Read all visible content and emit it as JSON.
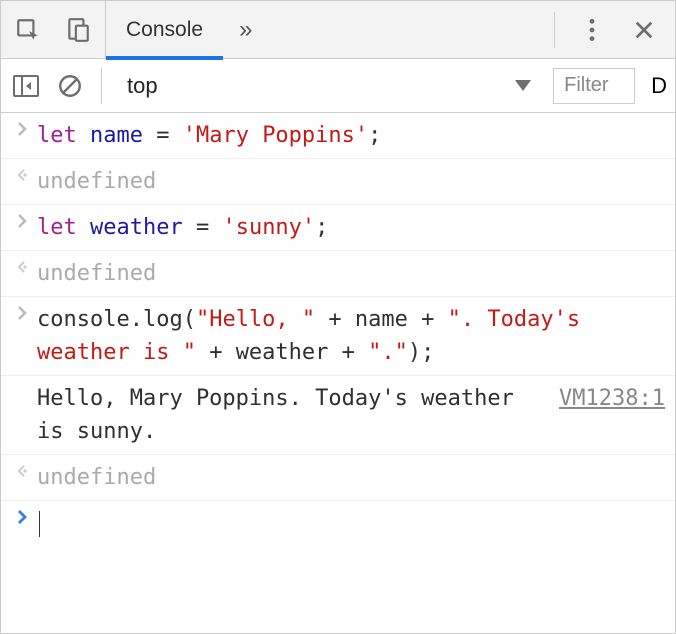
{
  "header": {
    "tabs": [
      {
        "label": "Console",
        "active": true
      }
    ],
    "moreGlyph": "»"
  },
  "toolbar": {
    "context": "top",
    "filterPlaceholder": "Filter",
    "rightText": "D"
  },
  "entries": [
    {
      "kind": "input",
      "code": {
        "segments": [
          {
            "t": "let ",
            "cls": "kw"
          },
          {
            "t": "name",
            "cls": "vname"
          },
          {
            "t": " = ",
            "cls": ""
          },
          {
            "t": "'Mary Poppins'",
            "cls": "str"
          },
          {
            "t": ";",
            "cls": ""
          }
        ]
      }
    },
    {
      "kind": "return",
      "text": "undefined"
    },
    {
      "kind": "input",
      "code": {
        "segments": [
          {
            "t": "let ",
            "cls": "kw"
          },
          {
            "t": "weather",
            "cls": "vname"
          },
          {
            "t": " = ",
            "cls": ""
          },
          {
            "t": "'sunny'",
            "cls": "str"
          },
          {
            "t": ";",
            "cls": ""
          }
        ]
      }
    },
    {
      "kind": "return",
      "text": "undefined"
    },
    {
      "kind": "input",
      "code": {
        "segments": [
          {
            "t": "console.log(",
            "cls": ""
          },
          {
            "t": "\"Hello, \"",
            "cls": "str"
          },
          {
            "t": " + name + ",
            "cls": ""
          },
          {
            "t": "\". Today's weather is \"",
            "cls": "str"
          },
          {
            "t": " + weather + ",
            "cls": ""
          },
          {
            "t": "\".\"",
            "cls": "str"
          },
          {
            "t": ");",
            "cls": ""
          }
        ]
      }
    },
    {
      "kind": "log",
      "text": "Hello, Mary Poppins. Today's weather is sunny.",
      "source": "VM1238:1"
    },
    {
      "kind": "return",
      "text": "undefined"
    }
  ],
  "prompt": {
    "value": ""
  }
}
